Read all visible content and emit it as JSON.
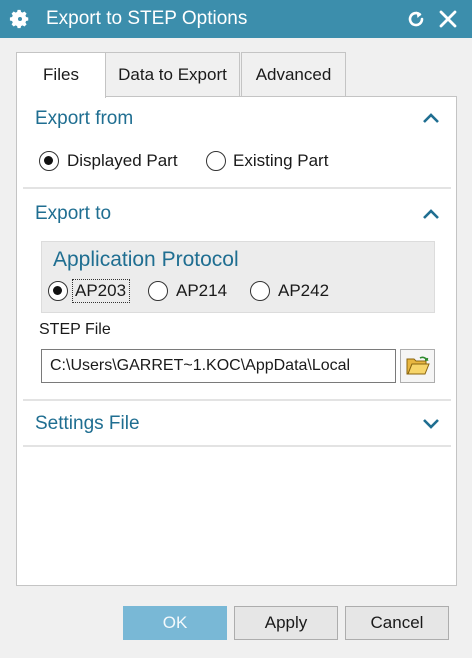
{
  "window": {
    "title": "Export to STEP Options",
    "gear_icon": "gear-icon",
    "reset_icon": "reset-icon",
    "close_icon": "close-icon",
    "accent_color": "#3c8eac"
  },
  "tabs": [
    {
      "label": "Files",
      "active": true
    },
    {
      "label": "Data to Export",
      "active": false
    },
    {
      "label": "Advanced",
      "active": false
    }
  ],
  "export_from": {
    "title": "Export from",
    "expanded": true,
    "options": [
      {
        "label": "Displayed Part",
        "selected": true
      },
      {
        "label": "Existing Part",
        "selected": false
      }
    ]
  },
  "export_to": {
    "title": "Export to",
    "expanded": true,
    "protocol_group": {
      "title": "Application Protocol",
      "options": [
        {
          "label": "AP203",
          "selected": true
        },
        {
          "label": "AP214",
          "selected": false
        },
        {
          "label": "AP242",
          "selected": false
        }
      ]
    },
    "step_file_label": "STEP File",
    "step_file_value": "C:\\Users\\GARRET~1.KOC\\AppData\\Local",
    "browse_icon": "folder-open-icon"
  },
  "settings_file": {
    "title": "Settings File",
    "expanded": false
  },
  "buttons": {
    "ok": "OK",
    "apply": "Apply",
    "cancel": "Cancel"
  }
}
